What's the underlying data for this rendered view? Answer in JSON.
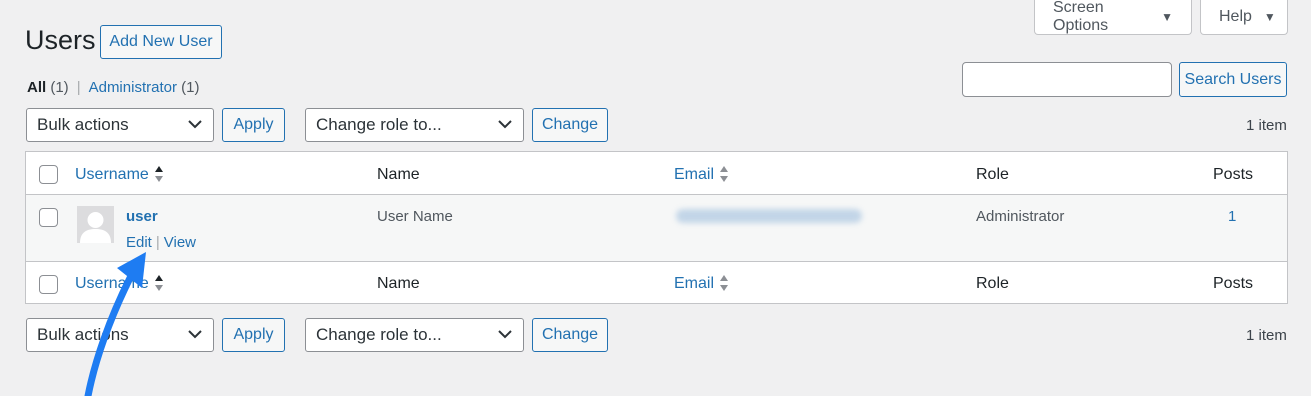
{
  "header": {
    "title": "Users",
    "add_new_label": "Add New User",
    "screen_options_label": "Screen Options",
    "help_label": "Help"
  },
  "filters": {
    "all_label": "All",
    "all_count": "(1)",
    "separator": "|",
    "admin_label": "Administrator",
    "admin_count": "(1)"
  },
  "search": {
    "value": "",
    "button_label": "Search Users"
  },
  "top_nav": {
    "bulk_actions": "Bulk actions",
    "apply_label": "Apply",
    "change_role": "Change role to...",
    "change_label": "Change",
    "item_count": "1 item"
  },
  "bottom_nav": {
    "bulk_actions": "Bulk actions",
    "apply_label": "Apply",
    "change_role": "Change role to...",
    "change_label": "Change",
    "item_count": "1 item"
  },
  "table": {
    "columns": {
      "username": "Username",
      "name": "Name",
      "email": "Email",
      "role": "Role",
      "posts": "Posts"
    },
    "rows": [
      {
        "username": "user",
        "name": "User Name",
        "role": "Administrator",
        "posts": "1",
        "actions": {
          "edit": "Edit",
          "separator": "|",
          "view": "View"
        }
      }
    ]
  },
  "colors": {
    "accent": "#2271b1",
    "arrow": "#1e7cf2",
    "background": "#f0f0f1"
  }
}
